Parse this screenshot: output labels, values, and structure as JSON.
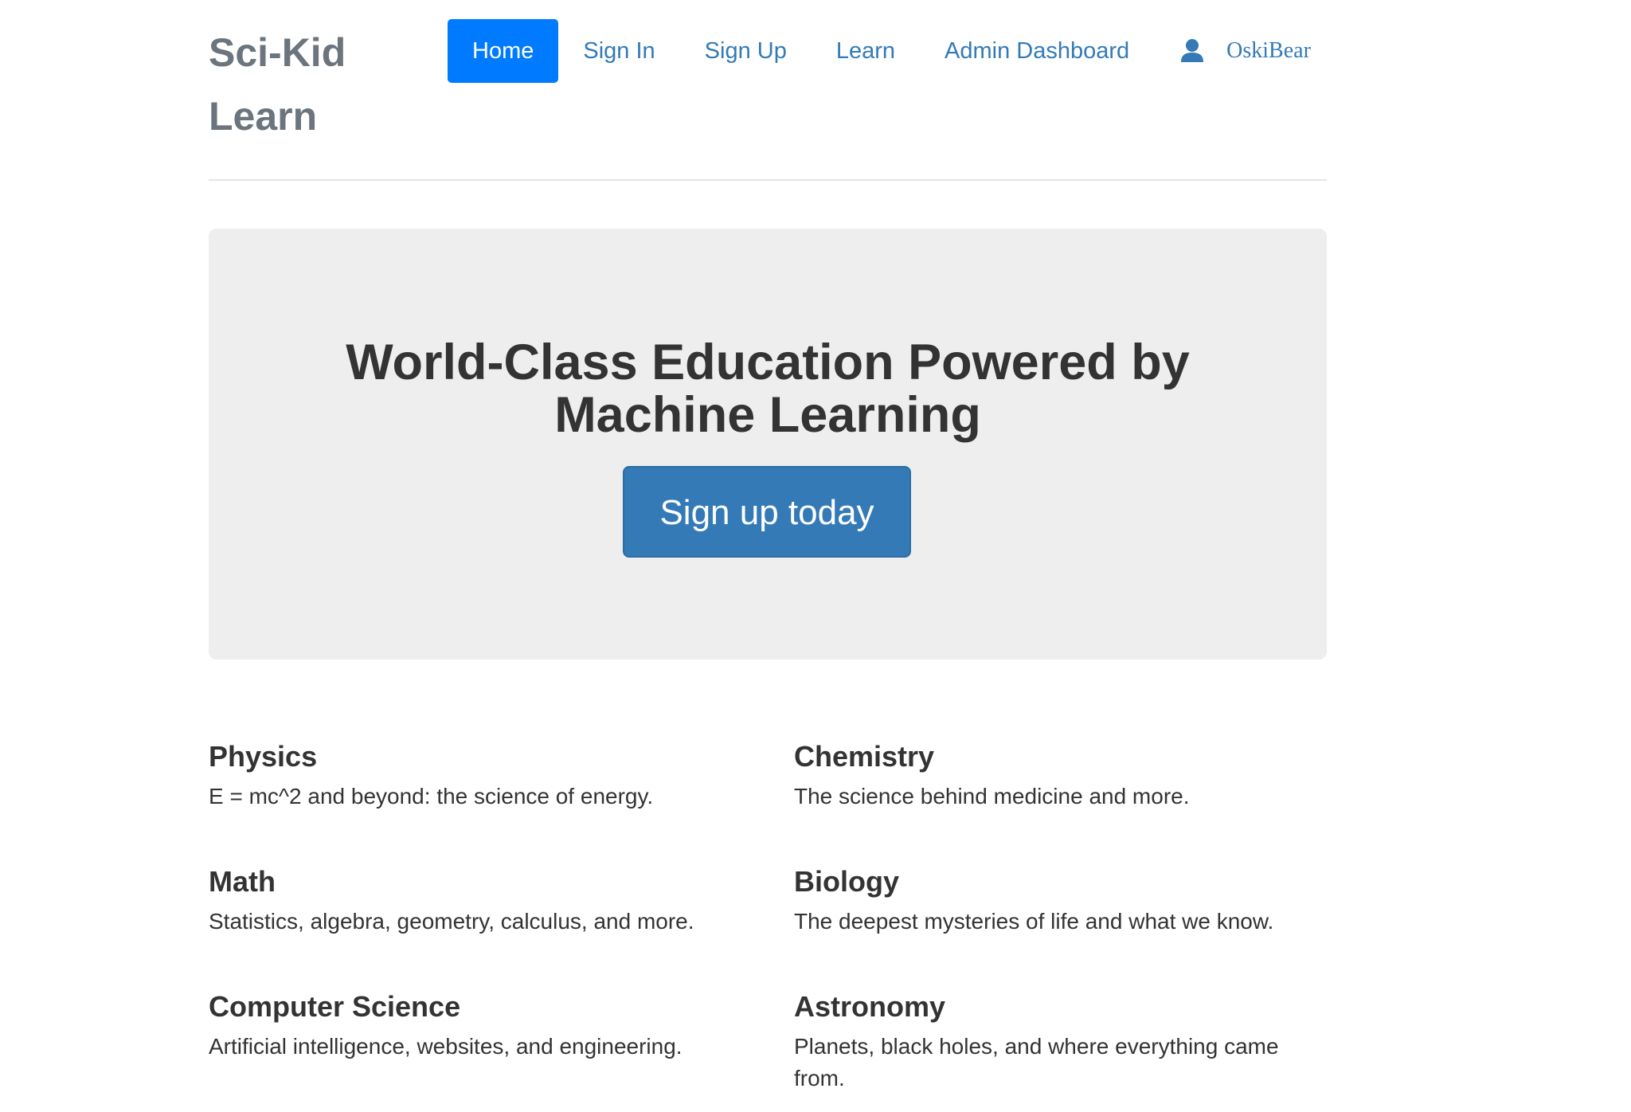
{
  "brand": {
    "title": "Sci-Kid Learn"
  },
  "nav": {
    "items": [
      {
        "label": "Home",
        "active": true
      },
      {
        "label": "Sign In"
      },
      {
        "label": "Sign Up"
      },
      {
        "label": "Learn"
      },
      {
        "label": "Admin Dashboard"
      }
    ],
    "user": {
      "icon": "user-icon",
      "name": "OskiBear"
    }
  },
  "hero": {
    "title": "World-Class Education Powered by Machine Learning",
    "button_label": "Sign up today"
  },
  "subjects": [
    {
      "title": "Physics",
      "description": "E = mc^2 and beyond: the science of energy."
    },
    {
      "title": "Chemistry",
      "description": "The science behind medicine and more."
    },
    {
      "title": "Math",
      "description": "Statistics, algebra, geometry, calculus, and more."
    },
    {
      "title": "Biology",
      "description": "The deepest mysteries of life and what we know."
    },
    {
      "title": "Computer Science",
      "description": "Artificial intelligence, websites, and engineering."
    },
    {
      "title": "Astronomy",
      "description": "Planets, black holes, and where everything came from."
    }
  ],
  "colors": {
    "link": "#337ab7",
    "active_nav": "#007bff",
    "hero_bg": "#eeeeee",
    "brand": "#6c757d"
  }
}
